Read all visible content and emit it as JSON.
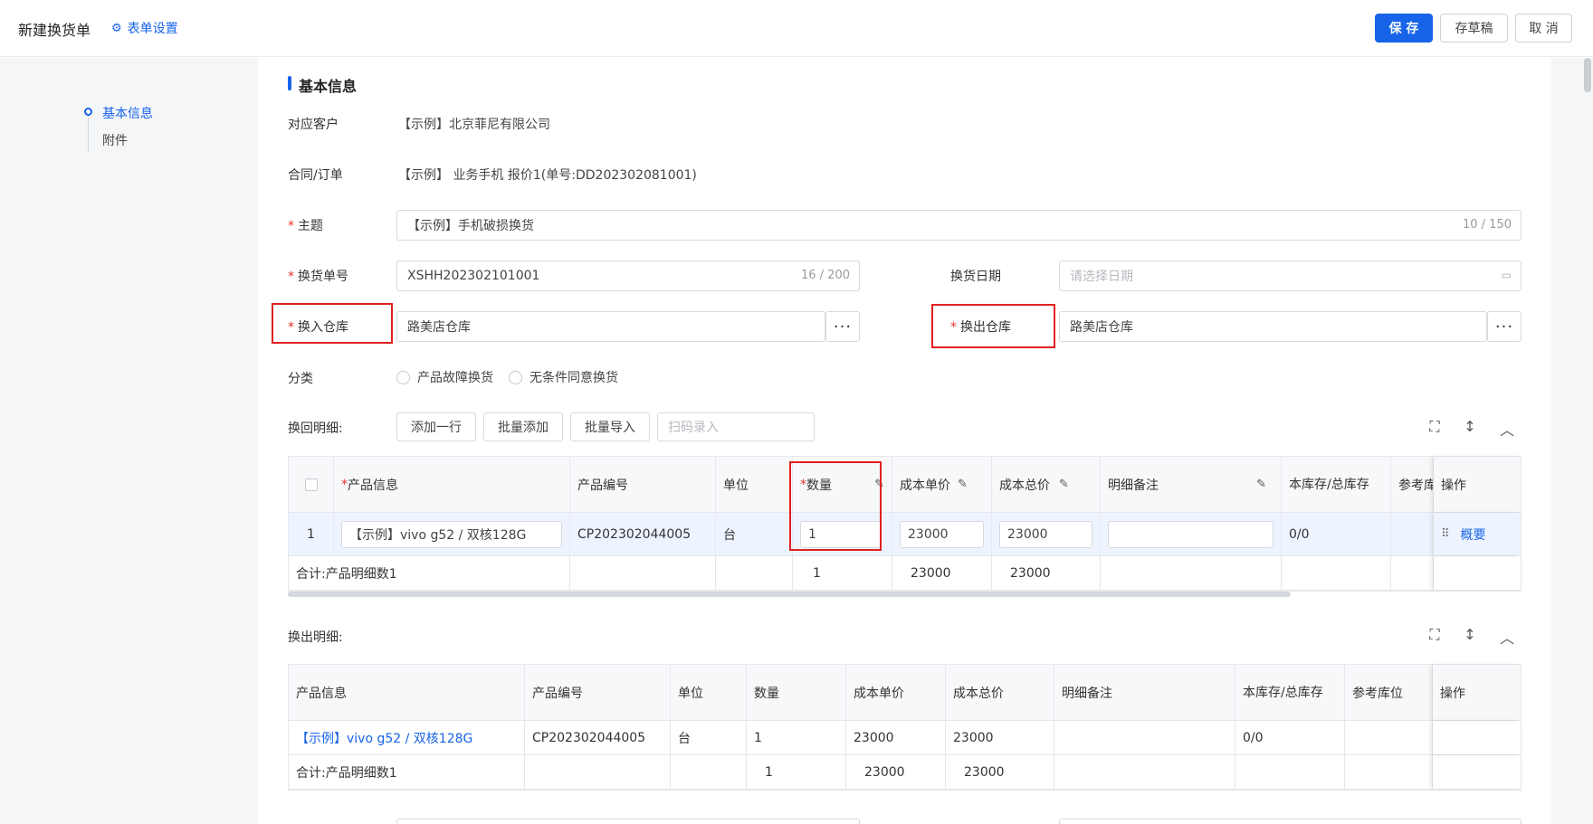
{
  "header": {
    "title": "新建换货单",
    "form_settings": "表单设置",
    "save": "保 存",
    "draft": "存草稿",
    "cancel": "取 消"
  },
  "anchors": [
    "基本信息",
    "附件"
  ],
  "section_title": "基本信息",
  "fields": {
    "customer_label": "对应客户",
    "customer_value": "【示例】北京菲尼有限公司",
    "contract_label": "合同/订单",
    "contract_value": "【示例】 业务手机 报价1(单号:DD202302081001)",
    "subject_label": "主题",
    "subject_value": "【示例】手机破损换货",
    "subject_counter": "10 / 150",
    "number_label": "换货单号",
    "number_value": "XSHH202302101001",
    "number_counter": "16 / 200",
    "date_label": "换货日期",
    "date_placeholder": "请选择日期",
    "in_wh_label": "换入仓库",
    "in_wh_value": "路美店仓库",
    "out_wh_label": "换出仓库",
    "out_wh_value": "路美店仓库",
    "category_label": "分类",
    "category_options": [
      "产品故障换货",
      "无条件同意换货"
    ],
    "dots": "···",
    "required_mark": "*"
  },
  "return_detail": {
    "label": "换回明细:",
    "add_row": "添加一行",
    "batch_add": "批量添加",
    "batch_import": "批量导入",
    "scan_placeholder": "扫码录入",
    "headers": [
      "产品信息",
      "产品编号",
      "单位",
      "数量",
      "成本单价",
      "成本总价",
      "明细备注",
      "本库存/总库存",
      "参考库",
      "操作"
    ],
    "row": {
      "index": "1",
      "product": "【示例】vivo g52 / 双核128G",
      "code": "CP202302044005",
      "unit": "台",
      "qty": "1",
      "unit_cost": "23000",
      "total_cost": "23000",
      "note": "",
      "stock": "0/0",
      "action": "概要"
    },
    "total": {
      "label": "合计:产品明细数1",
      "qty": "1",
      "unit_cost": "23000",
      "total_cost": "23000"
    }
  },
  "out_detail": {
    "label": "换出明细:",
    "headers": [
      "产品信息",
      "产品编号",
      "单位",
      "数量",
      "成本单价",
      "成本总价",
      "明细备注",
      "本库存/总库存",
      "参考库位",
      "操作"
    ],
    "row": {
      "product": "【示例】vivo g52 / 双核128G",
      "code": "CP202302044005",
      "unit": "台",
      "qty": "1",
      "unit_cost": "23000",
      "total_cost": "23000",
      "stock": "0/0"
    },
    "total": {
      "label": "合计:产品明细数1",
      "qty": "1",
      "unit_cost": "23000",
      "total_cost": "23000"
    }
  },
  "icons": {
    "gear": "⚙",
    "calendar": "📅",
    "pencil": "✎",
    "expand": "⛶",
    "vertical": "↕",
    "collapse": "︿",
    "drag": "⠿"
  },
  "colors": {
    "primary": "#1764e8",
    "required": "#e5312b",
    "highlight_box": "#e02020"
  }
}
